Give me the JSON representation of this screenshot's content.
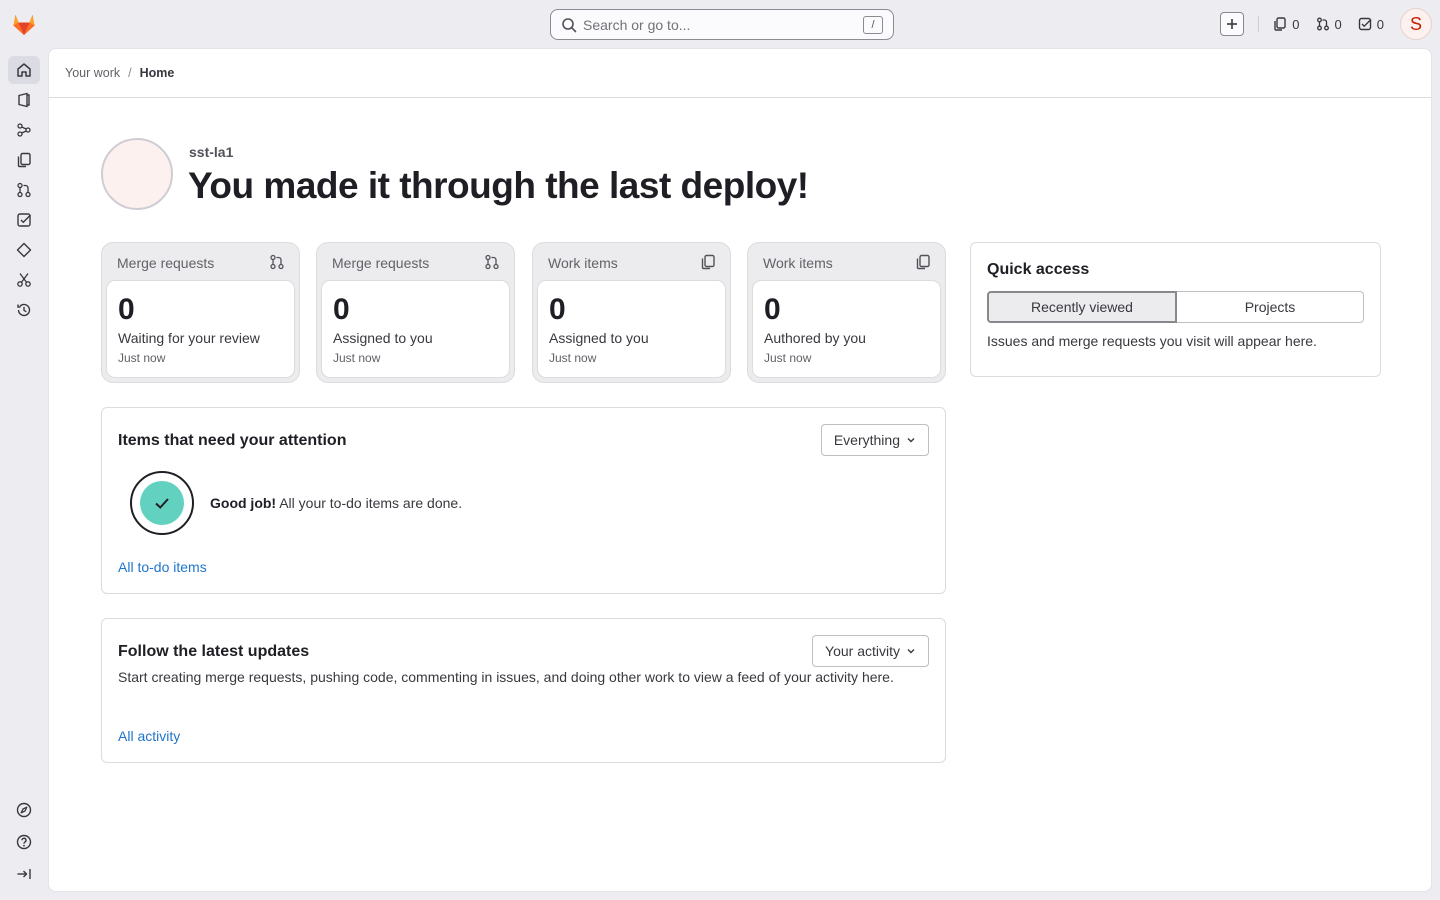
{
  "colors": {
    "accent": "#1f75cb",
    "success": "#63d1c0",
    "brand": "#e24329"
  },
  "topbar": {
    "search_placeholder": "Search or go to...",
    "search_shortcut": "/",
    "counters": [
      {
        "icon": "issues-icon",
        "value": "0"
      },
      {
        "icon": "merge-request-icon",
        "value": "0"
      },
      {
        "icon": "todo-icon",
        "value": "0"
      }
    ],
    "avatar_initial": "S"
  },
  "sidebar": {
    "items": [
      {
        "icon": "home-icon",
        "active": true
      },
      {
        "icon": "project-icon"
      },
      {
        "icon": "group-icon"
      },
      {
        "icon": "issues-icon"
      },
      {
        "icon": "merge-request-icon"
      },
      {
        "icon": "todo-icon"
      },
      {
        "icon": "milestone-icon"
      },
      {
        "icon": "snippet-icon"
      },
      {
        "icon": "activity-icon"
      }
    ],
    "bottom": [
      {
        "icon": "explore-icon"
      },
      {
        "icon": "help-icon"
      },
      {
        "icon": "collapse-icon"
      }
    ]
  },
  "breadcrumb": {
    "parent": "Your work",
    "separator": "/",
    "current": "Home"
  },
  "greeting": {
    "username": "sst-la1",
    "headline": "You made it through the last deploy!"
  },
  "stats": [
    {
      "title": "Merge requests",
      "icon": "merge-request-icon",
      "count": "0",
      "label": "Waiting for your review",
      "time": "Just now"
    },
    {
      "title": "Merge requests",
      "icon": "merge-request-icon",
      "count": "0",
      "label": "Assigned to you",
      "time": "Just now"
    },
    {
      "title": "Work items",
      "icon": "issues-icon",
      "count": "0",
      "label": "Assigned to you",
      "time": "Just now"
    },
    {
      "title": "Work items",
      "icon": "issues-icon",
      "count": "0",
      "label": "Authored by you",
      "time": "Just now"
    }
  ],
  "attention": {
    "title": "Items that need your attention",
    "filter": "Everything",
    "done_bold": "Good job!",
    "done_rest": " All your to-do items are done.",
    "link": "All to-do items"
  },
  "updates": {
    "title": "Follow the latest updates",
    "filter": "Your activity",
    "description": "Start creating merge requests, pushing code, commenting in issues, and doing other work to view a feed of your activity here.",
    "link": "All activity"
  },
  "quick_access": {
    "title": "Quick access",
    "tabs": [
      "Recently viewed",
      "Projects"
    ],
    "note": "Issues and merge requests you visit will appear here."
  }
}
